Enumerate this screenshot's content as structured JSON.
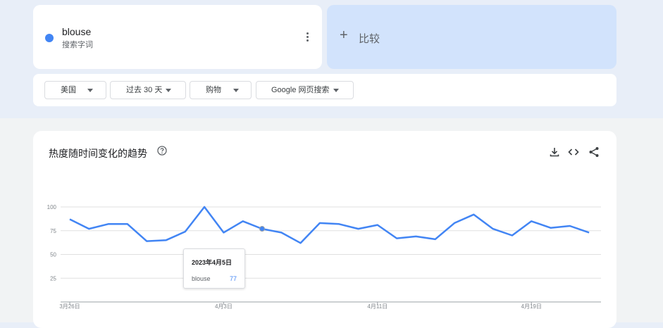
{
  "search_term": {
    "name": "blouse",
    "type_label": "搜索字词",
    "color": "#4285f4"
  },
  "compare": {
    "label": "比较"
  },
  "filters": [
    {
      "label": "美国"
    },
    {
      "label": "过去 30 天"
    },
    {
      "label": "购物"
    },
    {
      "label": "Google 网页搜索"
    }
  ],
  "chart_panel": {
    "title": "热度随时间变化的趋势"
  },
  "tooltip": {
    "date": "2023年4月5日",
    "term": "blouse",
    "value": "77"
  },
  "chart_data": {
    "type": "line",
    "title": "热度随时间变化的趋势",
    "x_tick_labels": [
      "3月26日",
      "4月3日",
      "4月11日",
      "4月19日"
    ],
    "x_tick_index": [
      0,
      8,
      16,
      24
    ],
    "y_ticks": [
      25,
      50,
      75,
      100
    ],
    "ylim": [
      0,
      100
    ],
    "grid": true,
    "series": [
      {
        "name": "blouse",
        "color": "#4285f4",
        "values": [
          87,
          77,
          82,
          82,
          64,
          65,
          74,
          100,
          73,
          85,
          77,
          73,
          62,
          83,
          82,
          77,
          81,
          67,
          69,
          66,
          83,
          92,
          77,
          70,
          85,
          78,
          80,
          73
        ]
      }
    ],
    "highlight_index": 10
  }
}
